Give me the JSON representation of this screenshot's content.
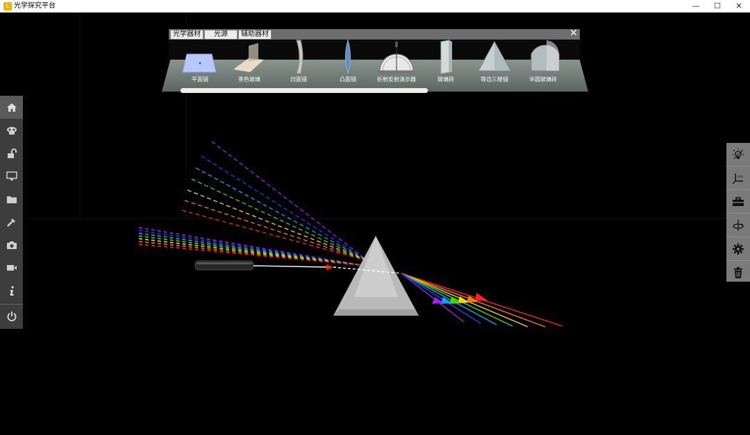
{
  "window": {
    "title": "光学探究平台",
    "app_icon_glyph": "L",
    "controls": [
      "minimize",
      "maximize",
      "close"
    ]
  },
  "library": {
    "tabs": [
      "光学器材",
      "光源",
      "辅助器材"
    ],
    "close_icon": "close-icon",
    "items": [
      {
        "label": "平面镜",
        "icon": "plane-mirror-icon"
      },
      {
        "label": "茶色玻璃",
        "icon": "tinted-glass-icon"
      },
      {
        "label": "凹面镜",
        "icon": "concave-mirror-icon"
      },
      {
        "label": "凸面镜",
        "icon": "convex-mirror-icon"
      },
      {
        "label": "折射反射演示器",
        "icon": "protractor-demo-icon"
      },
      {
        "label": "玻璃砖",
        "icon": "glass-brick-icon"
      },
      {
        "label": "等边三棱镜",
        "icon": "prism-icon"
      },
      {
        "label": "半圆玻璃砖",
        "icon": "half-cylinder-icon"
      }
    ]
  },
  "left_toolbar": [
    {
      "name": "home",
      "icon": "home-icon",
      "active": true
    },
    {
      "name": "scene",
      "icon": "scene-icon"
    },
    {
      "name": "lock",
      "icon": "unlock-icon"
    },
    {
      "name": "display",
      "icon": "monitor-icon"
    },
    {
      "name": "files",
      "icon": "folder-icon"
    },
    {
      "name": "tools",
      "icon": "tools-icon"
    },
    {
      "name": "screenshot",
      "icon": "camera-icon"
    },
    {
      "name": "record",
      "icon": "video-icon"
    },
    {
      "name": "info",
      "icon": "info-icon"
    },
    {
      "name": "exit",
      "icon": "power-icon"
    }
  ],
  "right_toolbar": [
    {
      "name": "light",
      "icon": "bulb-icon"
    },
    {
      "name": "axes",
      "icon": "axes-icon"
    },
    {
      "name": "toolbox",
      "icon": "toolbox-icon"
    },
    {
      "name": "rotate",
      "icon": "rotate-icon"
    },
    {
      "name": "settings",
      "icon": "gear-icon"
    },
    {
      "name": "delete",
      "icon": "trash-icon"
    }
  ],
  "spectrum_colors": [
    "#ff2020",
    "#ff7a00",
    "#ffd800",
    "#3cdc00",
    "#00a8ff",
    "#2040ff",
    "#a020f0"
  ],
  "beam_color": "#ffffff",
  "arrow_color": "#ff2020"
}
